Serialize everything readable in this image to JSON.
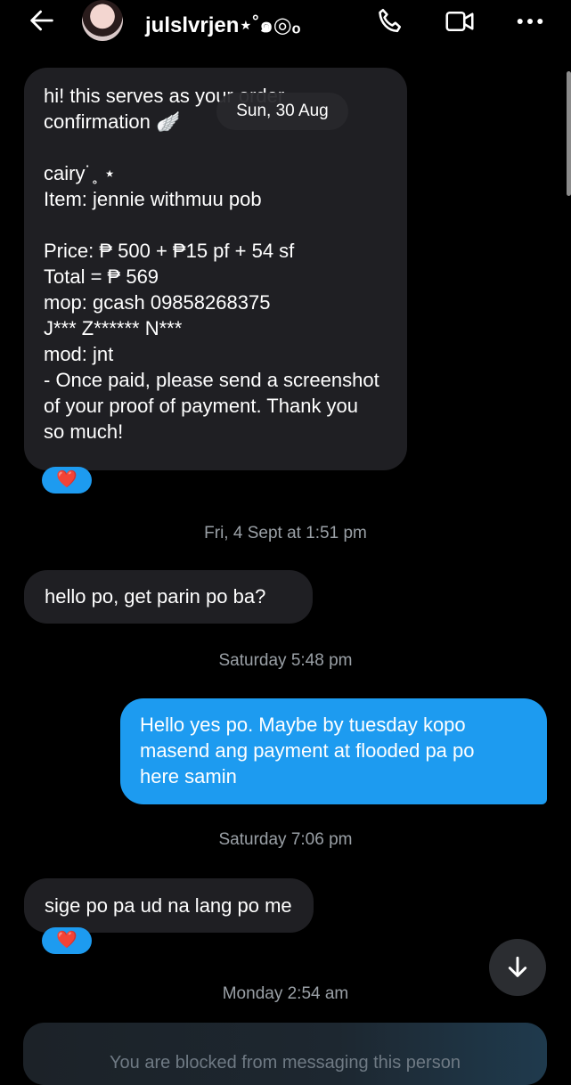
{
  "header": {
    "name": "julslvrjen⋆˚๑◎ₒ",
    "back_icon": "back-arrow-icon",
    "call_icon": "phone-icon",
    "video_icon": "video-camera-icon",
    "more_icon": "more-dots-icon"
  },
  "date_pill": "Sun, 30 Aug",
  "messages": [
    {
      "text": "hi! this serves as your order\nconfirmation 🪽\n\ncairy˙˳ ⋆\nItem: jennie withmuu pob\n\nPrice: ₱ 500 + ₱15 pf + 54 sf\nTotal = ₱ 569\nmop: gcash 09858268375\nJ*** Z****** N***\nmod: jnt\n- Once paid, please send a screenshot\nof your proof of payment. Thank you\nso much!",
      "reaction": "❤️"
    },
    {
      "timestamp": "Fri, 4 Sept at 1:51 pm",
      "text": "hello po, get parin po ba?"
    },
    {
      "timestamp": "Saturday 5:48 pm",
      "text": "Hello yes po. Maybe by tuesday kopo\nmasend ang payment at flooded pa po\nhere samin"
    },
    {
      "timestamp": "Saturday 7:06 pm",
      "text": "sige po pa ud na lang po me",
      "reaction": "❤️"
    },
    {
      "timestamp": "Monday 2:54 am"
    }
  ],
  "blocked_text": "You are blocked from messaging this person",
  "colors": {
    "accent": "#1d9bf0",
    "incoming_bubble": "#1f1f23",
    "background": "#000000"
  }
}
